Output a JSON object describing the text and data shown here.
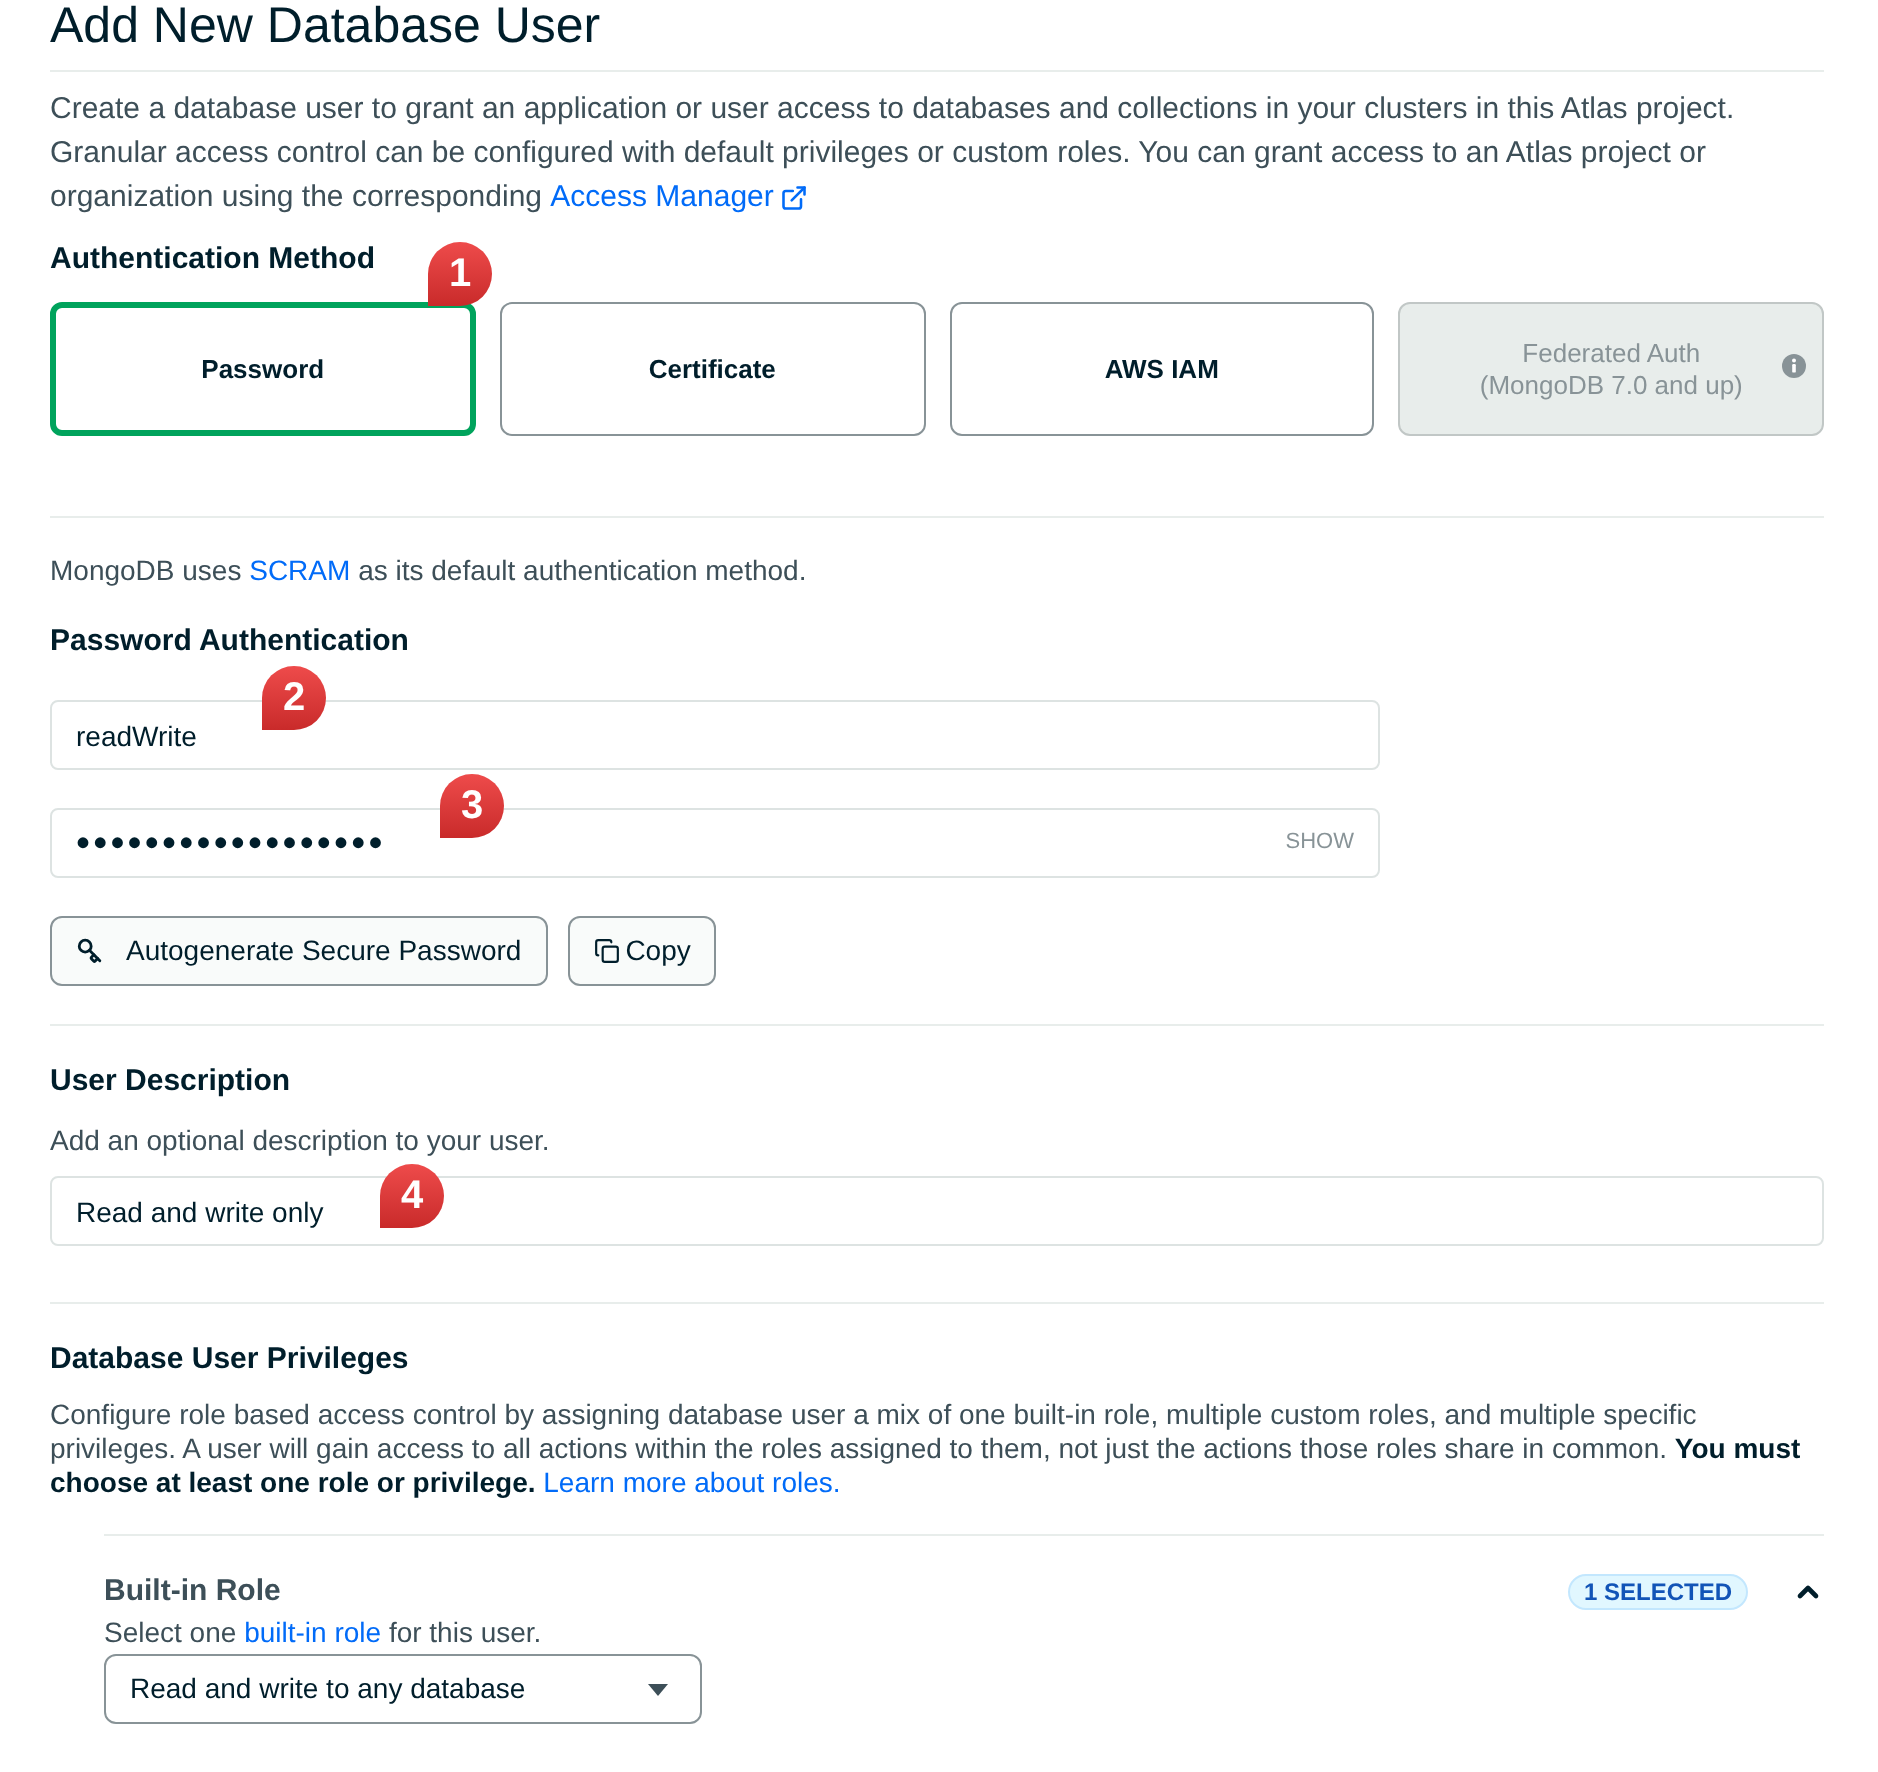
{
  "page": {
    "title": "Add New Database User",
    "intro": "Create a database user to grant an application or user access to databases and collections in your clusters in this Atlas project. Granular access control can be configured with default privileges or custom roles. You can grant access to an Atlas project or organization using the corresponding",
    "intro_link": "Access Manager"
  },
  "authentication_method": {
    "label": "Authentication Method",
    "options": [
      {
        "label": "Password",
        "selected": true,
        "disabled": false,
        "info": false
      },
      {
        "label": "Certificate",
        "selected": false,
        "disabled": false,
        "info": false
      },
      {
        "label": "AWS IAM",
        "selected": false,
        "disabled": false,
        "info": false
      },
      {
        "label": "Federated Auth",
        "sublabel": "(MongoDB 7.0 and up)",
        "selected": false,
        "disabled": true,
        "info": true
      }
    ]
  },
  "scram_note": {
    "before": "MongoDB uses",
    "link": "SCRAM",
    "after": "as its default authentication method."
  },
  "password_authentication": {
    "label": "Password Authentication",
    "username": {
      "value": "readWrite"
    },
    "password": {
      "value": "••••••••••••••••••",
      "toggle": "SHOW"
    },
    "buttons": [
      {
        "label": "Autogenerate Secure Password"
      },
      {
        "label": "Copy"
      }
    ]
  },
  "user_description": {
    "label": "User Description",
    "hint": "Add an optional description to your user.",
    "field": {
      "value": "Read and write only"
    }
  },
  "privileges": {
    "label": "Database User Privileges",
    "description": "Configure role based access control by assigning database user a mix of one built-in role, multiple custom roles, and multiple specific privileges. A user will gain access to all actions within the roles assigned to them, not just the actions those roles share in common. **You must choose at least one role or privilege.**",
    "link": "Learn more about roles."
  },
  "built_in_role": {
    "label": "Built-in Role",
    "badge": "1 SELECTED",
    "expanded": true,
    "hint_before": "Select one",
    "hint_link": "built-in role",
    "hint_after": "for this user.",
    "select": {
      "value": "Read and write to any database"
    }
  },
  "callouts": [
    {
      "label": "1"
    },
    {
      "label": "2"
    },
    {
      "label": "3"
    },
    {
      "label": "4"
    }
  ]
}
